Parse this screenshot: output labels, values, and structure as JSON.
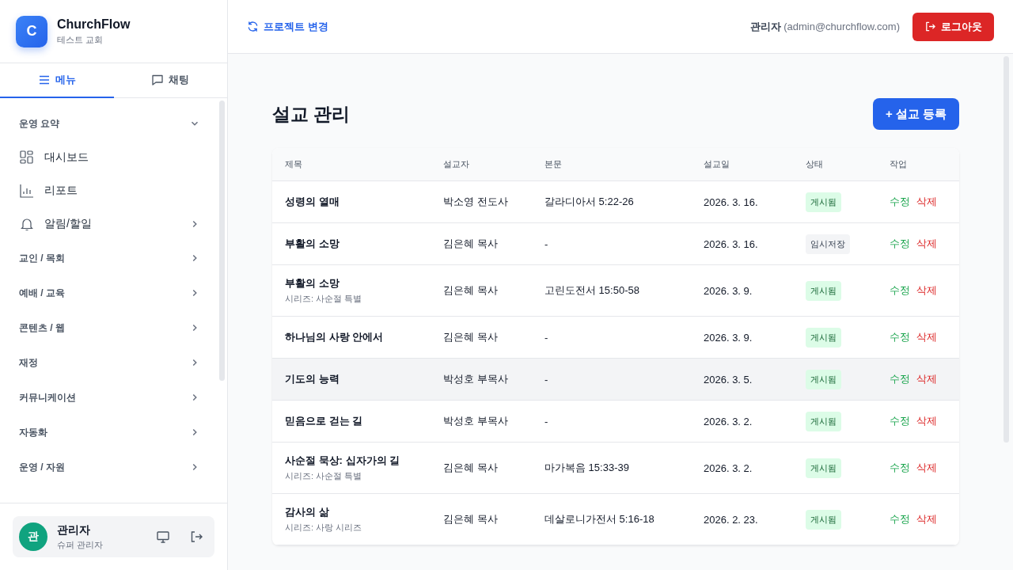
{
  "brand": {
    "logo_letter": "C",
    "name": "ChurchFlow",
    "subtitle": "테스트 교회"
  },
  "sidebar": {
    "tabs": [
      {
        "label": "메뉴",
        "selected": true
      },
      {
        "label": "채팅",
        "selected": false
      }
    ],
    "groups": [
      {
        "label": "운영 요약",
        "expanded": true,
        "children": [
          {
            "label": "대시보드",
            "expandable": false
          },
          {
            "label": "리포트",
            "expandable": false
          },
          {
            "label": "알림/할일",
            "expandable": true
          }
        ]
      },
      {
        "label": "교인 / 목회",
        "expanded": false
      },
      {
        "label": "예배 / 교육",
        "expanded": false
      },
      {
        "label": "콘텐츠 / 웹",
        "expanded": false
      },
      {
        "label": "재정",
        "expanded": false
      },
      {
        "label": "커뮤니케이션",
        "expanded": false
      },
      {
        "label": "자동화",
        "expanded": false
      },
      {
        "label": "운영 / 자원",
        "expanded": false
      }
    ],
    "user": {
      "avatar": "관",
      "name": "관리자",
      "role": "슈퍼 관리자"
    }
  },
  "topbar": {
    "project_link": "프로젝트 변경",
    "user_name": "관리자",
    "user_email": "(admin@churchflow.com)",
    "logout": "로그아웃"
  },
  "page": {
    "title": "설교 관리",
    "add_button": "+ 설교 등록"
  },
  "table": {
    "columns": [
      "제목",
      "설교자",
      "본문",
      "설교일",
      "상태",
      "작업"
    ],
    "rows": [
      {
        "title": "성령의 열매",
        "preacher": "박소영 전도사",
        "passage": "갈라디아서 5:22-26",
        "date": "2026. 3. 16.",
        "status": {
          "label": "게시됨",
          "kind": "published"
        },
        "edit": "수정",
        "delete": "삭제",
        "selected": false
      },
      {
        "title": "부활의 소망",
        "preacher": "김은혜 목사",
        "passage": "-",
        "date": "2026. 3. 16.",
        "status": {
          "label": "임시저장",
          "kind": "draft"
        },
        "edit": "수정",
        "delete": "삭제",
        "selected": false
      },
      {
        "title": "부활의 소망",
        "series": "시리즈: 사순절 특별",
        "preacher": "김은혜 목사",
        "passage": "고린도전서 15:50-58",
        "date": "2026. 3. 9.",
        "status": {
          "label": "게시됨",
          "kind": "published"
        },
        "edit": "수정",
        "delete": "삭제",
        "selected": false
      },
      {
        "title": "하나님의 사랑 안에서",
        "preacher": "김은혜 목사",
        "passage": "-",
        "date": "2026. 3. 9.",
        "status": {
          "label": "게시됨",
          "kind": "published"
        },
        "edit": "수정",
        "delete": "삭제",
        "selected": false
      },
      {
        "title": "기도의 능력",
        "preacher": "박성호 부목사",
        "passage": "-",
        "date": "2026. 3. 5.",
        "status": {
          "label": "게시됨",
          "kind": "published"
        },
        "edit": "수정",
        "delete": "삭제",
        "selected": true
      },
      {
        "title": "믿음으로 걷는 길",
        "preacher": "박성호 부목사",
        "passage": "-",
        "date": "2026. 3. 2.",
        "status": {
          "label": "게시됨",
          "kind": "published"
        },
        "edit": "수정",
        "delete": "삭제",
        "selected": false
      },
      {
        "title": "사순절 묵상: 십자가의 길",
        "series": "시리즈: 사순절 특별",
        "preacher": "김은혜 목사",
        "passage": "마가복음 15:33-39",
        "date": "2026. 3. 2.",
        "status": {
          "label": "게시됨",
          "kind": "published"
        },
        "edit": "수정",
        "delete": "삭제",
        "selected": false
      },
      {
        "title": "감사의 삶",
        "series": "시리즈: 사랑 시리즈",
        "preacher": "김은혜 목사",
        "passage": "데살로니가전서 5:16-18",
        "date": "2026. 2. 23.",
        "status": {
          "label": "게시됨",
          "kind": "published"
        },
        "edit": "수정",
        "delete": "삭제",
        "selected": false
      }
    ]
  }
}
